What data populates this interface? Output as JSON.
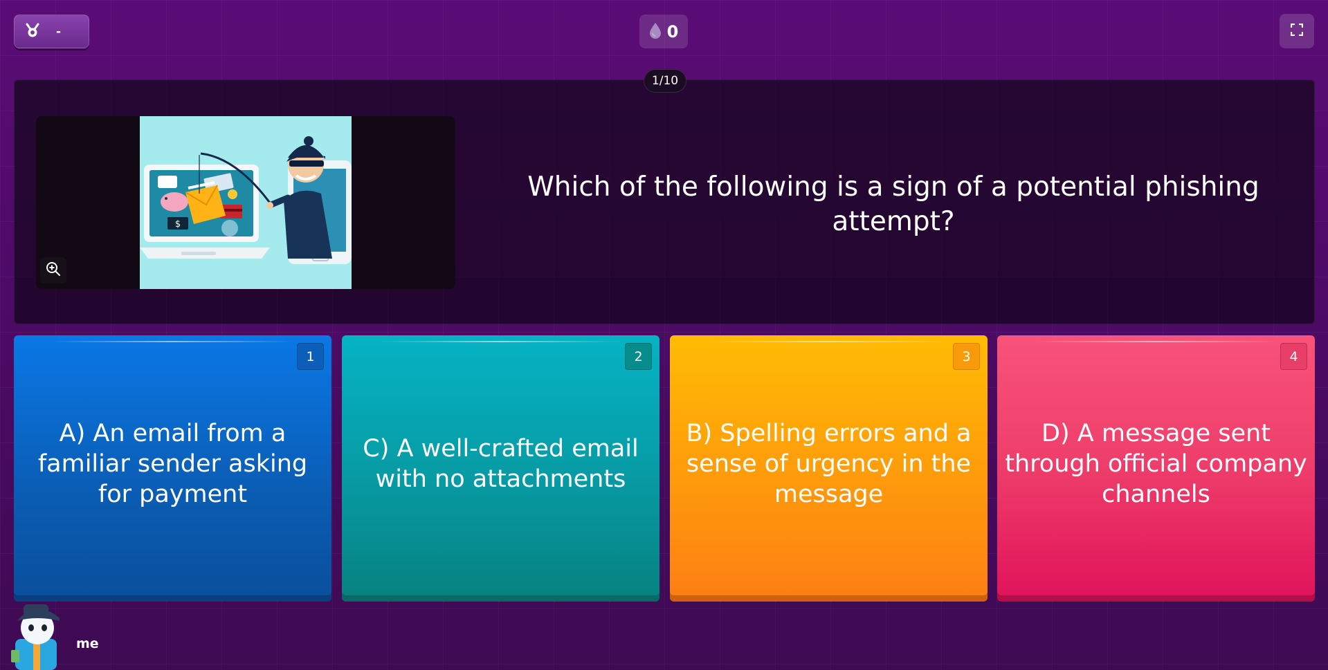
{
  "header": {
    "rank_value": "-",
    "coin_count": "0"
  },
  "question": {
    "counter": "1/10",
    "text": "Which of the following is a sign of a potential phishing attempt?",
    "image_alt": "Hacker phishing from a phone into a laptop full of emails, money and cards"
  },
  "answers": [
    {
      "key": "1",
      "text": "A) An email from a familiar sender asking for payment",
      "color": "#0a6fd6"
    },
    {
      "key": "2",
      "text": "C) A well-crafted email with no attachments",
      "color": "#07a0ac"
    },
    {
      "key": "3",
      "text": "B) Spelling errors and a sense of urgency in the message",
      "color": "#ff9a0c"
    },
    {
      "key": "4",
      "text": "D) A message sent through official company channels",
      "color": "#ea2f63"
    }
  ],
  "player": {
    "name": "me"
  },
  "icons": {
    "rank": "medal-icon",
    "coin": "droplet-icon",
    "fullscreen": "fullscreen-icon",
    "zoom": "zoom-in-icon"
  }
}
